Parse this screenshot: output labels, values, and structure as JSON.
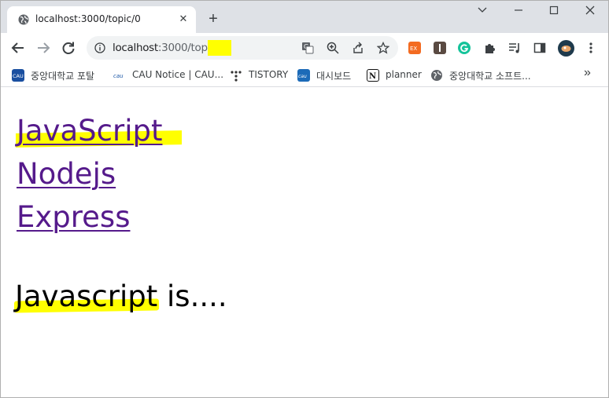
{
  "window": {
    "tab_title": "localhost:3000/topic/0",
    "tab_icon": "globe-icon",
    "controls": [
      "minimize-icon",
      "maximize-icon",
      "close-icon"
    ]
  },
  "toolbar": {
    "url_host": "localhost",
    "url_rest": ":3000/topic/0",
    "url_highlight_color": "#ffff00"
  },
  "bookmarks": [
    {
      "label": "중앙대학교 포탈",
      "icon": "cau-portal-icon",
      "color": "#1a4fa0"
    },
    {
      "label": "CAU Notice | CAU...",
      "icon": "cau-notice-icon",
      "color": "#1f5aa8"
    },
    {
      "label": "TISTORY",
      "icon": "tistory-icon",
      "color": "#333333"
    },
    {
      "label": "대시보드",
      "icon": "cau-dashboard-icon",
      "color": "#1c6bb8"
    },
    {
      "label": "planner",
      "icon": "notion-icon",
      "color": "#111111"
    },
    {
      "label": "중앙대학교 소프트...",
      "icon": "globe-icon",
      "color": "#5f6368"
    }
  ],
  "page": {
    "links": [
      "JavaScript",
      "Nodejs",
      "Express"
    ],
    "description_highlighted": "Javascript",
    "description_rest": " is....",
    "link_color": "#551a8b",
    "highlight_color": "#ffff00"
  }
}
